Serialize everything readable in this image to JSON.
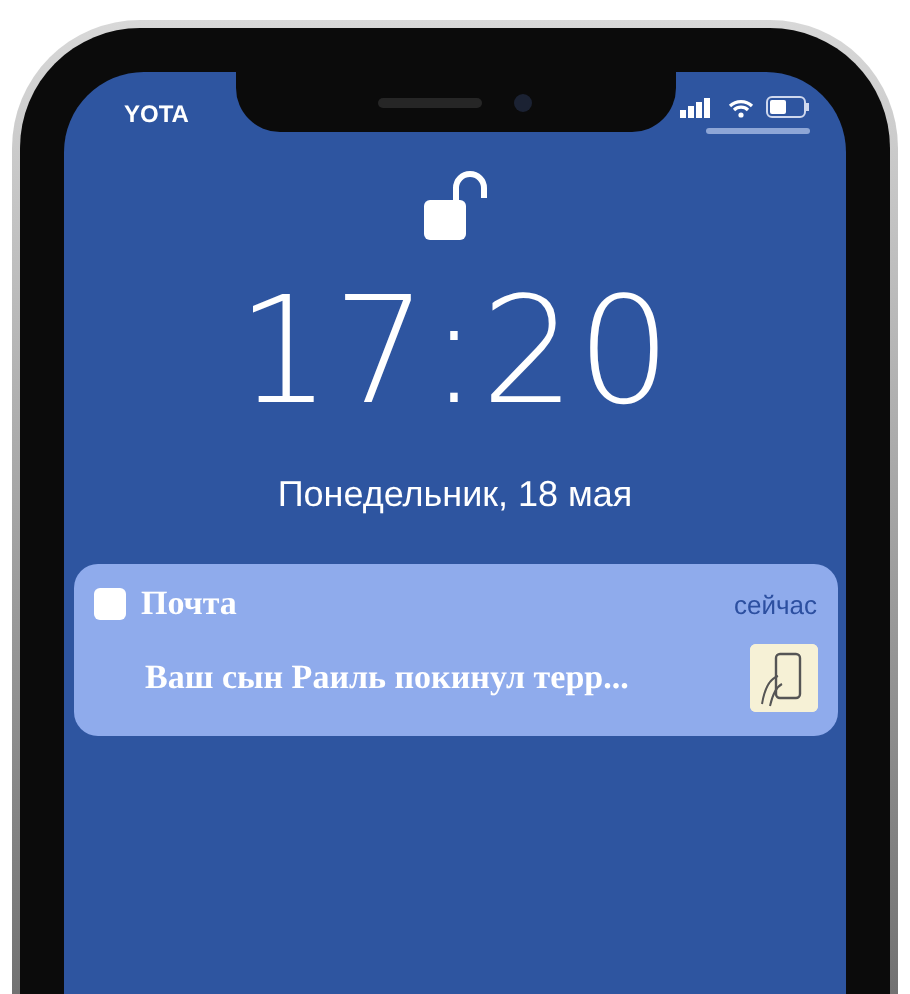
{
  "status_bar": {
    "carrier": "YOTA"
  },
  "lock_screen": {
    "locked": false,
    "time": "17:20",
    "date": "Понедельник, 18 мая"
  },
  "notification": {
    "app": "Почта",
    "time": "сейчас",
    "message": "Ваш сын Раиль покинул терр..."
  }
}
